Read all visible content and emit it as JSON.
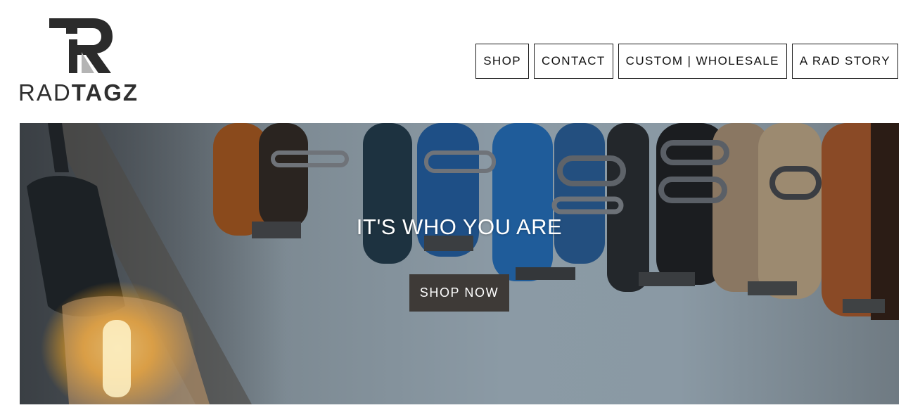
{
  "brand": {
    "logo_thin": "RAD",
    "logo_bold": "TAGZ"
  },
  "nav": {
    "items": [
      {
        "label": "SHOP"
      },
      {
        "label": "CONTACT"
      },
      {
        "label": "CUSTOM | WHOLESALE"
      },
      {
        "label": "A RAD STORY"
      }
    ]
  },
  "hero": {
    "title": "IT'S WHO YOU ARE",
    "cta_label": "SHOP NOW"
  },
  "colors": {
    "cta_background": "#3e3a37",
    "text_dark": "#111111",
    "nav_border": "#1a1a1a"
  }
}
